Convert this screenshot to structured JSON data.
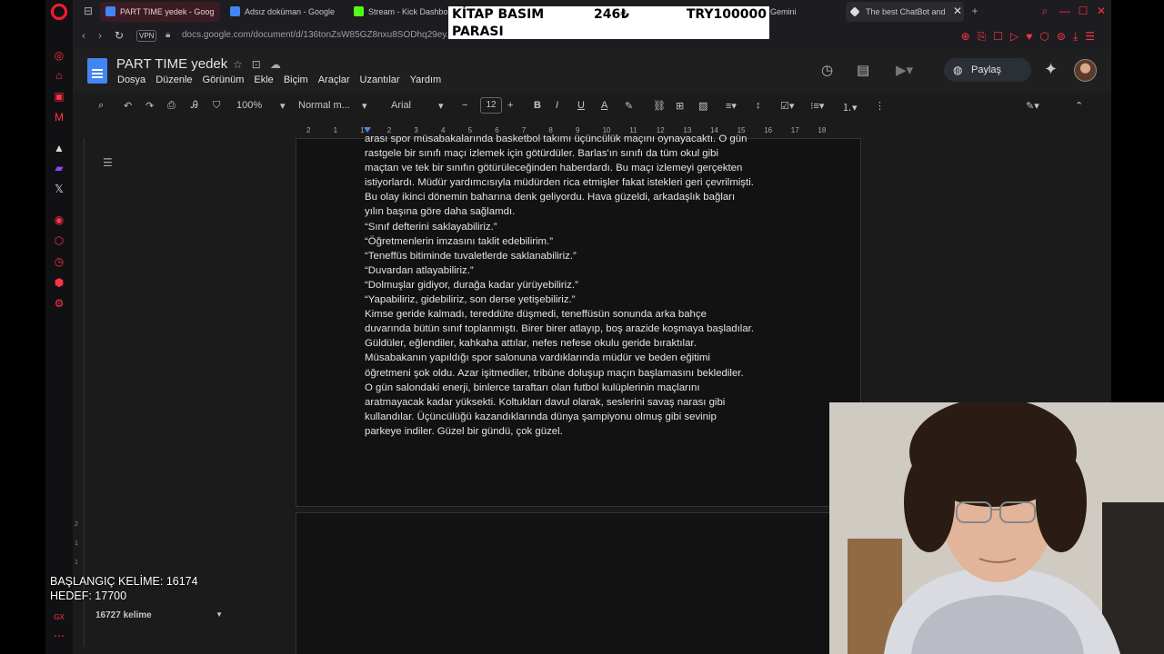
{
  "browser": {
    "tabs": [
      {
        "label": "PART TIME yedek - Goog",
        "color": "#4285f4",
        "active": true
      },
      {
        "label": "Adsız doküman - Google",
        "color": "#4285f4",
        "active": false
      },
      {
        "label": "Stream - Kick Dashbo",
        "color": "#53fc18",
        "active": false
      },
      {
        "label": "Gemini",
        "color": "#8ab4f8",
        "active": false
      },
      {
        "label": "The best ChatBot and",
        "color": "#ffffff",
        "active": false
      }
    ],
    "url": "docs.google.com/document/d/136tonZsW85GZ8nxu8SODhq29ey...",
    "vpn_label": "VPN"
  },
  "overlay": {
    "line1_left": "KİTAP BASIM",
    "line2_left": "PARASI",
    "amount": "246₺",
    "goal": "TRY100000"
  },
  "docs": {
    "title": "PART TIME  yedek",
    "menu": [
      "Dosya",
      "Düzenle",
      "Görünüm",
      "Ekle",
      "Biçim",
      "Araçlar",
      "Uzantılar",
      "Yardım"
    ],
    "share_label": "Paylaş",
    "zoom": "100%",
    "style": "Normal m...",
    "font": "Arial",
    "font_size": "12",
    "ruler_ticks": [
      "2",
      "1",
      "1",
      "2",
      "3",
      "4",
      "5",
      "6",
      "7",
      "8",
      "9",
      "10",
      "11",
      "12",
      "13",
      "14",
      "15",
      "16",
      "17",
      "18"
    ],
    "word_count": "16727 kelime",
    "paragraph_lines": [
      "arası spor müsabakalarında basketbol takımı üçüncülük maçını oynayacaktı. O gün",
      "rastgele bir sınıfı maçı izlemek için götürdüler. Barlas'ın sınıfı da tüm okul gibi",
      "maçtan ve tek bir sınıfın götürüleceğinden haberdardı. Bu maçı izlemeyi gerçekten",
      "istiyorlardı. Müdür yardımcısıyla müdürden rica etmişler fakat istekleri geri çevrilmişti.",
      "Bu olay ikinci dönemin baharına denk geliyordu. Hava güzeldi, arkadaşlık bağları",
      "yılın başına göre daha sağlamdı.",
      "“Sınıf defterini saklayabiliriz.”",
      "“Öğretmenlerin imzasını taklit edebilirim.”",
      "“Teneffüs bitiminde tuvaletlerde saklanabiliriz.”",
      "“Duvardan atlayabiliriz.”",
      "“Dolmuşlar gidiyor, durağa kadar yürüyebiliriz.”",
      "“Yapabiliriz, gidebiliriz, son derse yetişebiliriz.”",
      "Kimse geride kalmadı, tereddüte düşmedi, teneffüsün sonunda arka bahçe",
      "duvarında bütün sınıf toplanmıştı. Birer birer atlayıp, boş arazide koşmaya başladılar.",
      "Güldüler, eğlendiler, kahkaha attılar, nefes nefese okulu geride bıraktılar.",
      "Müsabakanın yapıldığı spor salonuna vardıklarında müdür ve beden eğitimi",
      "öğretmeni şok oldu. Azar işitmediler, tribüne doluşup maçın başlamasını beklediler.",
      "O gün salondaki enerji, binlerce taraftarı olan futbol kulüplerinin maçlarını",
      "aratmayacak kadar yüksekti. Koltukları davul olarak, seslerini savaş narası gibi",
      "kullandılar. Üçüncülüğü kazandıklarında dünya şampiyonu olmuş gibi sevinip",
      "parkeye indiler. Güzel bir gündü, çok güzel."
    ]
  },
  "stream_stats": {
    "start_words": "BAŞLANGIÇ KELİME: 16174",
    "target": "HEDEF: 17700"
  }
}
